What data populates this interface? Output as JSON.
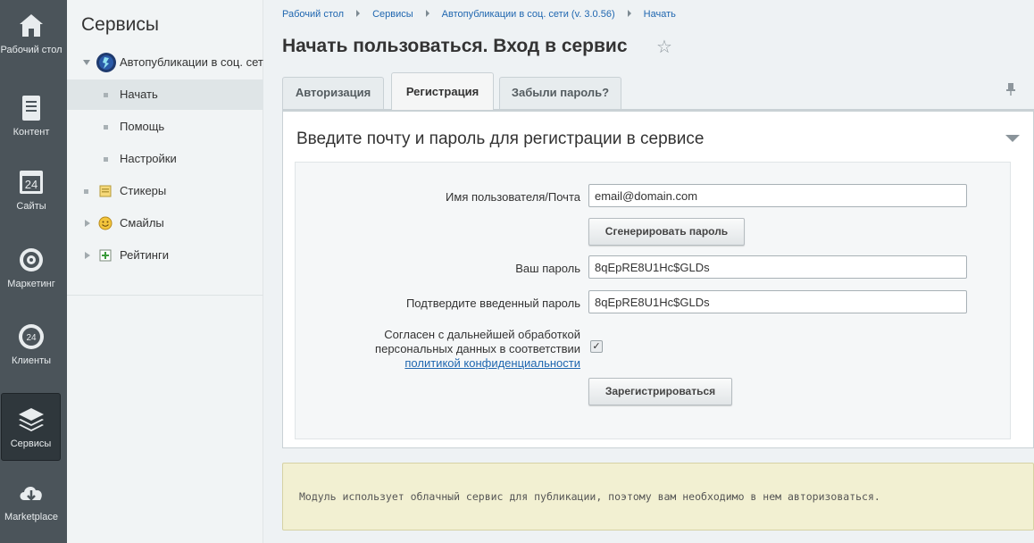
{
  "rail": {
    "items": [
      {
        "label": "Рабочий стол",
        "icon": "home-icon"
      },
      {
        "label": "Контент",
        "icon": "document-icon"
      },
      {
        "label": "Сайты",
        "icon": "calendar-24-icon"
      },
      {
        "label": "Маркетинг",
        "icon": "target-icon"
      },
      {
        "label": "Клиенты",
        "icon": "crm-24-icon"
      },
      {
        "label": "Сервисы",
        "icon": "layers-icon",
        "active": true
      },
      {
        "label": "Marketplace",
        "icon": "cloud-download-icon"
      }
    ]
  },
  "menu": {
    "title": "Сервисы",
    "items": [
      {
        "label": "Автопубликации в соц. сетях",
        "icon": "autopublish-app-icon",
        "expanded": true
      },
      {
        "label": "Начать",
        "active": true
      },
      {
        "label": "Помощь"
      },
      {
        "label": "Настройки"
      },
      {
        "label": "Стикеры",
        "icon": "sticker-icon"
      },
      {
        "label": "Смайлы",
        "icon": "smile-icon"
      },
      {
        "label": "Рейтинги",
        "icon": "rating-icon"
      }
    ]
  },
  "breadcrumbs": [
    "Рабочий стол",
    "Сервисы",
    "Автопубликации в соц. сети (v. 3.0.56)",
    "Начать"
  ],
  "page": {
    "title": "Начать пользоваться. Вход в сервис"
  },
  "tabs": [
    "Авторизация",
    "Регистрация",
    "Забыли пароль?"
  ],
  "active_tab": "Регистрация",
  "panel": {
    "title": "Введите почту и пароль для регистрации в сервисе"
  },
  "form": {
    "username_label": "Имя пользователя/Почта",
    "username_value": "email@domain.com",
    "generate_button": "Сгенерировать пароль",
    "password_label": "Ваш пароль",
    "password_value": "8qEpRE8U1Hc$GLDs",
    "confirm_label": "Подтвердите введенный пароль",
    "confirm_value": "8qEpRE8U1Hc$GLDs",
    "consent_line1": "Согласен с дальнейшей обработкой",
    "consent_line2": "персональных данных в соответствии",
    "consent_link": "политикой конфиденциальности",
    "consent_checked": true,
    "submit_button": "Зарегистрироваться"
  },
  "notice": {
    "text": "Модуль использует облачный сервис для публикации, поэтому вам необходимо в нем авторизоваться."
  },
  "colors": {
    "rail_bg": "#4b545a",
    "link": "#2067b0",
    "notice_bg": "#f2f0d2"
  }
}
